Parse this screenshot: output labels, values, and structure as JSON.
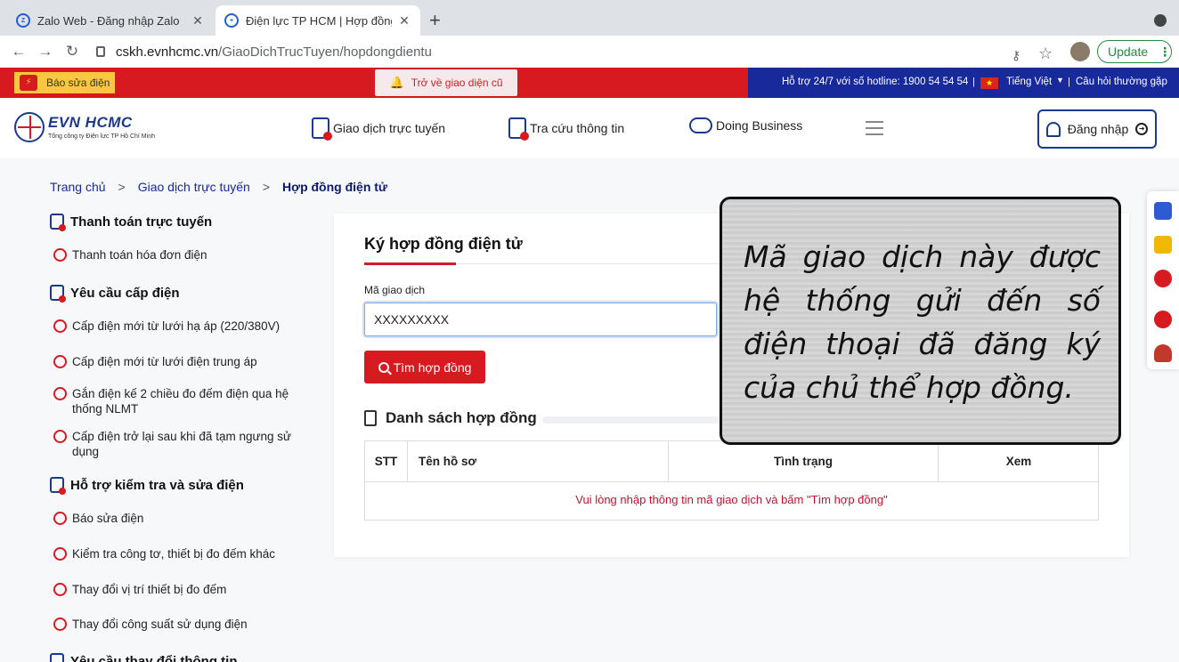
{
  "browser": {
    "tabs": [
      {
        "title": "Zalo Web - Đăng nhập Zalo",
        "active": false
      },
      {
        "title": "Điện lực TP HCM | Hợp đồng đ",
        "active": true
      }
    ],
    "new_tab": "+",
    "url_host": "cskh.evnhcmc.vn",
    "url_path": "/GiaoDichTrucTuyen/hopdongdientu",
    "update_label": "Update"
  },
  "topbar": {
    "report_label": "Báo sửa điện",
    "old_ui_label": "Trở về giao diện cũ",
    "hotline": "Hỗ trợ 24/7 với số hotline: 1900 54 54 54",
    "separator": "|",
    "language": "Tiếng Việt",
    "faq": "Câu hỏi thường gặp"
  },
  "header": {
    "logo_name": "EVN HCMC",
    "logo_sub": "Tổng công ty Điện lực TP Hồ Chí Minh",
    "nav": [
      {
        "label": "Giao dịch trực tuyến"
      },
      {
        "label": "Tra cứu thông tin"
      },
      {
        "label": "Doing Business"
      }
    ],
    "login_label": "Đăng nhập"
  },
  "breadcrumb": {
    "home": "Trang chủ",
    "section": "Giao dịch trực tuyến",
    "current": "Hợp đồng điện tử",
    "sep": ">"
  },
  "sidebar": {
    "sections": [
      {
        "title": "Thanh toán trực tuyến",
        "items": [
          "Thanh toán hóa đơn điện"
        ]
      },
      {
        "title": "Yêu cầu cấp điện",
        "items": [
          "Cấp điện mới từ lưới hạ áp (220/380V)",
          "Cấp điện mới từ lưới điện trung áp",
          "Gắn điện kế 2 chiều đo đếm điện qua hệ thống NLMT",
          "Cấp điện trở lại sau khi đã tạm ngưng sử dụng"
        ]
      },
      {
        "title": "Hỗ trợ kiểm tra và sửa điện",
        "items": [
          "Báo sửa điện",
          "Kiểm tra công tơ, thiết bị đo đếm khác",
          "Thay đổi vị trí thiết bị đo đếm",
          "Thay đổi công suất sử dụng điện"
        ]
      },
      {
        "title": "Yêu cầu thay đổi thông tin",
        "items": []
      }
    ]
  },
  "form": {
    "title": "Ký hợp đồng điện tử",
    "field_label": "Mã giao dịch",
    "field_value": "XXXXXXXXX",
    "find_label": "Tìm hợp đồng",
    "list_title": "Danh sách hợp đồng"
  },
  "table": {
    "headers": [
      "STT",
      "Tên hồ sơ",
      "Tình trạng",
      "Xem"
    ],
    "empty_message": "Vui lòng nhập thông tin mã giao dịch và bấm \"Tìm hợp đồng\""
  },
  "annotation": {
    "text": "Mã giao dịch này được hệ thống gửi đến số điện thoại đã đăng ký của chủ thể hợp đồng."
  },
  "colors": {
    "brand_red": "#d71920",
    "brand_blue": "#17299b",
    "update_green": "#1e8e3e"
  },
  "icons": [
    "zalo-icon",
    "evn-favicon",
    "lock-icon",
    "key-icon",
    "star-icon",
    "bell-icon",
    "flag-vn-icon",
    "user-icon",
    "search-icon",
    "document-icon",
    "calculator-icon",
    "help-icon",
    "phone-icon",
    "support-agent-icon"
  ]
}
